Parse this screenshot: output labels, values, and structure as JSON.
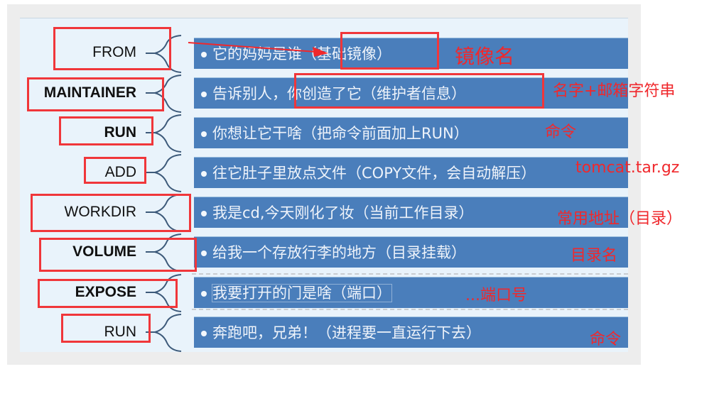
{
  "rows": [
    {
      "keyword": "FROM",
      "desc": "它的妈妈是谁（基础镜像）",
      "bold": false
    },
    {
      "keyword": "MAINTAINER",
      "desc": "告诉别人，你创造了它（维护者信息）",
      "bold": true
    },
    {
      "keyword": "RUN",
      "desc": "你想让它干啥（把命令前面加上RUN）",
      "bold": true
    },
    {
      "keyword": "ADD",
      "desc": "往它肚子里放点文件（COPY文件，会自动解压）",
      "bold": false
    },
    {
      "keyword": "WORKDIR",
      "desc": "我是cd,今天刚化了妆（当前工作目录）",
      "bold": false
    },
    {
      "keyword": "VOLUME",
      "desc": "给我一个存放行李的地方（目录挂载）",
      "bold": true
    },
    {
      "keyword": "EXPOSE",
      "desc": "我要打开的门是啥（端口）",
      "bold": true
    },
    {
      "keyword": "RUN",
      "desc": "奔跑吧，兄弟！（进程要一直运行下去）",
      "bold": false
    }
  ],
  "annotations": {
    "from": "镜像名",
    "maintainer": "名字+邮箱字符串",
    "run": "命令",
    "add": "tomcat.tar.gz",
    "workdir": "常用地址（目录）",
    "volume": "目录名",
    "expose": "...端口号",
    "run2": "命令"
  },
  "colors": {
    "bar": "#4a7ebb",
    "annotation": "#f0282c",
    "panel": "#e9f3fb"
  }
}
